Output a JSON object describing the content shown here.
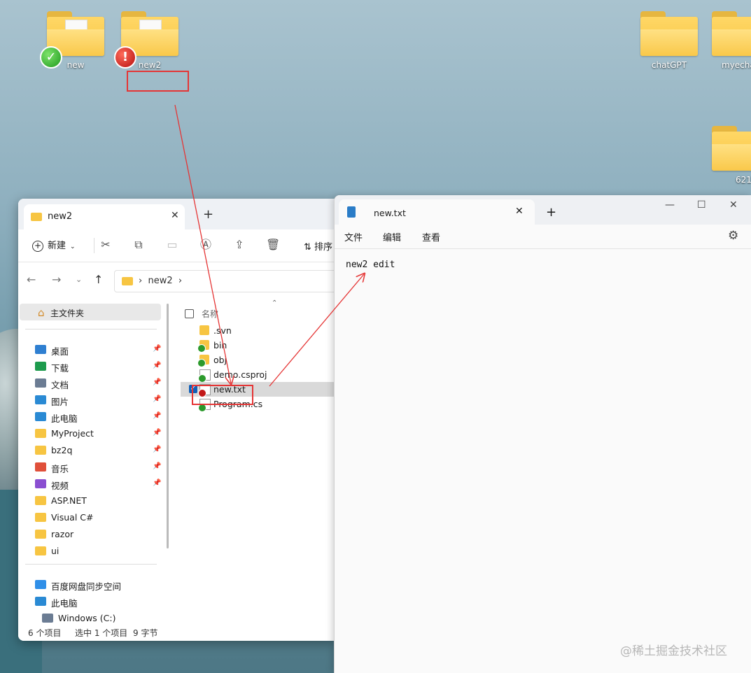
{
  "desktop": {
    "icons": [
      {
        "label": "new"
      },
      {
        "label": "new2"
      },
      {
        "label": "chatGPT"
      },
      {
        "label": "myecha"
      },
      {
        "label": "621"
      }
    ]
  },
  "explorer": {
    "tab_title": "new2",
    "tab_close": "✕",
    "new_tab": "+",
    "toolbar": {
      "new_label": "新建",
      "sort_label": "排序"
    },
    "breadcrumb": {
      "separator": "›",
      "path": "new2"
    },
    "nav": {
      "home": "主文件夹",
      "quick_items": [
        {
          "label": "桌面",
          "color": "#2f7fd1"
        },
        {
          "label": "下载",
          "color": "#1d9b4d"
        },
        {
          "label": "文档",
          "color": "#6b7c93"
        },
        {
          "label": "图片",
          "color": "#2a8ad4"
        },
        {
          "label": "此电脑",
          "color": "#2a8ad4"
        },
        {
          "label": "MyProject",
          "color": "#f7c542"
        },
        {
          "label": "bz2q",
          "color": "#f7c542"
        },
        {
          "label": "音乐",
          "color": "#e0503a"
        },
        {
          "label": "视频",
          "color": "#8a4fd1"
        },
        {
          "label": "ASP.NET",
          "color": "#f7c542"
        },
        {
          "label": "Visual C#",
          "color": "#f7c542"
        },
        {
          "label": "razor",
          "color": "#f7c542"
        },
        {
          "label": "ui",
          "color": "#f7c542"
        }
      ],
      "bottom_items": [
        {
          "label": "百度网盘同步空间",
          "color": "#2f8fe8"
        },
        {
          "label": "此电脑",
          "color": "#2a8ad4"
        },
        {
          "label": "Windows (C:)",
          "color": "#6b7c93"
        }
      ]
    },
    "files": {
      "header": "名称",
      "rows": [
        {
          "name": ".svn",
          "type": "folder",
          "status": ""
        },
        {
          "name": "bin",
          "type": "folder",
          "status": "ok"
        },
        {
          "name": "obj",
          "type": "folder",
          "status": "ok"
        },
        {
          "name": "demo.csproj",
          "type": "file",
          "status": "ok"
        },
        {
          "name": "new.txt",
          "type": "file",
          "status": "modified",
          "selected": true
        },
        {
          "name": "Program.cs",
          "type": "file",
          "status": "ok"
        }
      ]
    },
    "status_bar": {
      "count": "6 个项目",
      "selected": "选中 1 个项目",
      "size": "9 字节"
    }
  },
  "notepad": {
    "tab_title": "new.txt",
    "tab_close": "✕",
    "new_tab": "+",
    "window_controls": {
      "minimize": "—",
      "maximize": "☐",
      "close": "✕"
    },
    "menu": {
      "file": "文件",
      "edit": "编辑",
      "view": "查看"
    },
    "content": "new2 edit"
  },
  "watermark": "@稀土掘金技术社区"
}
